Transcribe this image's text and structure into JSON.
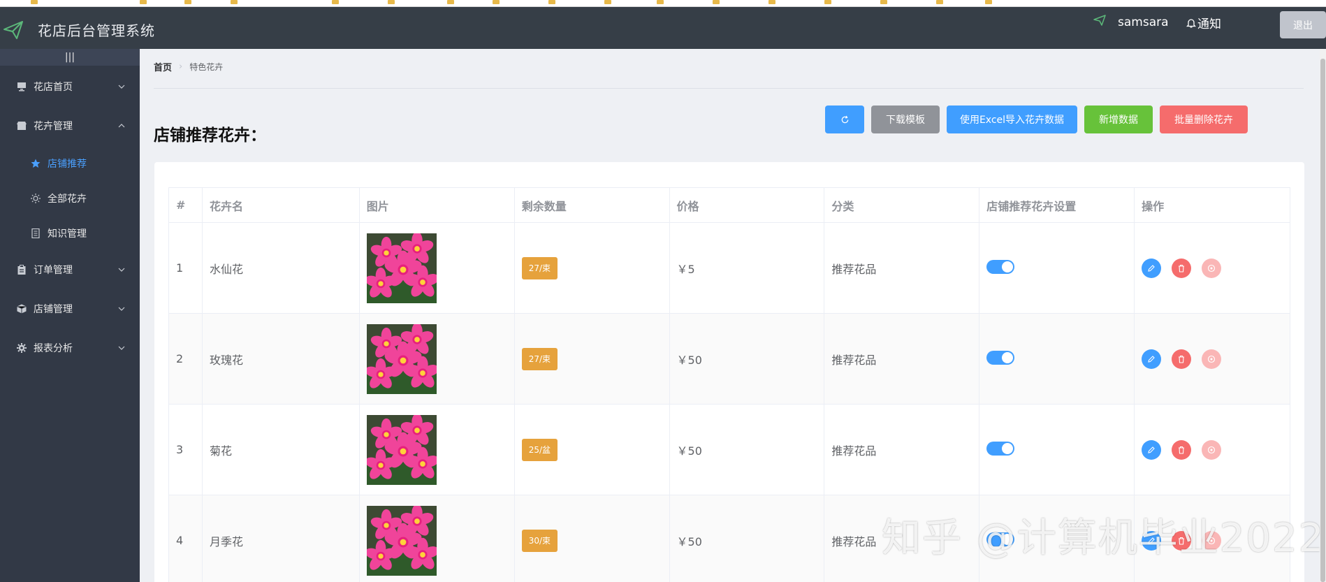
{
  "header": {
    "app_title": "花店后台管理系统",
    "username": "samsara",
    "notice_label": "通知",
    "logout_label": "退出"
  },
  "sidebar": {
    "collapse_label": "|||",
    "items": [
      {
        "label": "花店首页",
        "icon": "monitor-icon",
        "expanded": false
      },
      {
        "label": "花卉管理",
        "icon": "shop-icon",
        "expanded": true
      },
      {
        "label": "订单管理",
        "icon": "clipboard-icon",
        "expanded": false
      },
      {
        "label": "店铺管理",
        "icon": "box-icon",
        "expanded": false
      },
      {
        "label": "报表分析",
        "icon": "gear-icon",
        "expanded": false
      }
    ],
    "sub_items": [
      {
        "label": "店铺推荐",
        "icon": "star-icon",
        "active": true
      },
      {
        "label": "全部花卉",
        "icon": "sun-icon",
        "active": false
      },
      {
        "label": "知识管理",
        "icon": "document-icon",
        "active": false
      }
    ]
  },
  "breadcrumb": {
    "home": "首页",
    "current": "特色花卉"
  },
  "page": {
    "title": "店铺推荐花卉："
  },
  "toolbar": {
    "template_label": "下载模板",
    "import_label": "使用Excel导入花卉数据",
    "add_label": "新增数据",
    "batch_delete_label": "批量删除花卉"
  },
  "table": {
    "headers": [
      "#",
      "花卉名",
      "图片",
      "剩余数量",
      "价格",
      "分类",
      "店铺推荐花卉设置",
      "操作"
    ],
    "rows": [
      {
        "index": "1",
        "name": "水仙花",
        "stock": "27/束",
        "price": "￥5",
        "category": "推荐花品",
        "recommended": true
      },
      {
        "index": "2",
        "name": "玫瑰花",
        "stock": "27/束",
        "price": "￥50",
        "category": "推荐花品",
        "recommended": true
      },
      {
        "index": "3",
        "name": "菊花",
        "stock": "25/盆",
        "price": "￥50",
        "category": "推荐花品",
        "recommended": true
      },
      {
        "index": "4",
        "name": "月季花",
        "stock": "30/束",
        "price": "￥50",
        "category": "推荐花品",
        "recommended": true
      }
    ]
  },
  "watermark": "知乎 @计算机毕业2022",
  "colors": {
    "primary": "#409eff",
    "info": "#909399",
    "success": "#67c23a",
    "danger": "#f56c6c",
    "warning": "#e6a23c",
    "header_bg": "#363e47",
    "sidebar_bg": "#323946"
  }
}
